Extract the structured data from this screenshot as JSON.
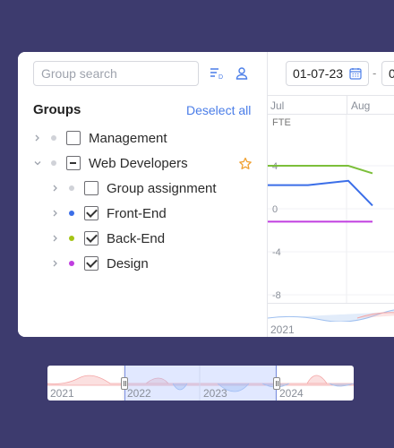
{
  "sidebar": {
    "search_placeholder": "Group search",
    "title": "Groups",
    "deselect_label": "Deselect all",
    "groups": [
      {
        "label": "Management",
        "state": "unchecked",
        "color": "#d0d2d8"
      },
      {
        "label": "Web Developers",
        "state": "partial",
        "color": "#d0d2d8",
        "favorite": true
      },
      {
        "label": "Group assignment",
        "state": "unchecked",
        "color": "#d0d2d8"
      },
      {
        "label": "Front-End",
        "state": "checked",
        "color": "#3b6ee8"
      },
      {
        "label": "Back-End",
        "state": "checked",
        "color": "#a4c414"
      },
      {
        "label": "Design",
        "state": "checked",
        "color": "#c03ee0"
      }
    ]
  },
  "timeline": {
    "start_date": "01-07-23",
    "end_date_partial": "0",
    "months": [
      "Jul",
      "Aug"
    ],
    "mini_year": "2021"
  },
  "chart_data": {
    "type": "line",
    "ylabel": "FTE",
    "y_ticks": [
      "4",
      "0",
      "-4",
      "-8"
    ],
    "ylim": [
      -8,
      8
    ],
    "series": [
      {
        "name": "Back-End",
        "color": "#7cbf3a",
        "x": [
          0,
          1,
          2,
          2.6
        ],
        "values": [
          4,
          4,
          4,
          3.3
        ]
      },
      {
        "name": "Front-End",
        "color": "#3b6ee8",
        "x": [
          0,
          1,
          2,
          2.6
        ],
        "values": [
          2.2,
          2.2,
          2.6,
          0.3
        ]
      },
      {
        "name": "Design",
        "color": "#c03ee0",
        "x": [
          0,
          1,
          2,
          2.6
        ],
        "values": [
          -1.2,
          -1.2,
          -1.2,
          -1.2
        ]
      }
    ]
  },
  "scroller": {
    "years": [
      "2021",
      "2022",
      "2023",
      "2024"
    ]
  }
}
